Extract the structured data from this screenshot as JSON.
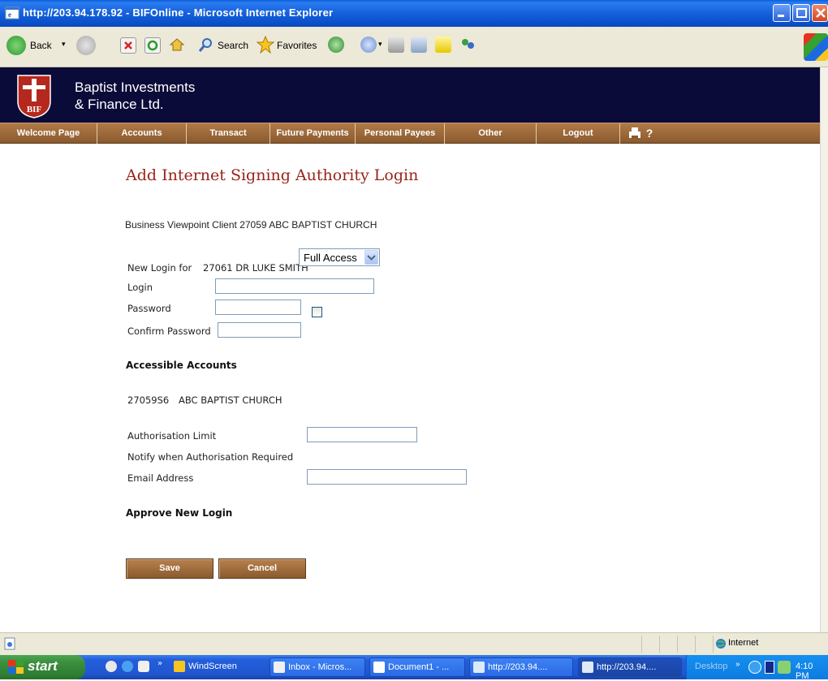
{
  "window": {
    "title": "http://203.94.178.92 - BIFOnline - Microsoft Internet Explorer"
  },
  "toolbar": {
    "back_label": "Back",
    "search_label": "Search",
    "favorites_label": "Favorites"
  },
  "bank": {
    "name_line1": "Baptist Investments",
    "name_line2": "& Finance Ltd.",
    "logo_text": "BIF"
  },
  "nav": {
    "items": [
      {
        "label": "Welcome Page"
      },
      {
        "label": "Accounts"
      },
      {
        "label": "Transact"
      },
      {
        "label": "Future Payments"
      },
      {
        "label": "Personal Payees"
      },
      {
        "label": "Other"
      },
      {
        "label": "Logout"
      }
    ],
    "help_label": "?"
  },
  "page": {
    "title": "Add Internet Signing Authority Login",
    "client_line": "Business Viewpoint Client 27059 ABC BAPTIST CHURCH",
    "new_login_for_label": "New Login for",
    "new_login_for_value": "27061 DR LUKE SMITH",
    "login_label": "Login",
    "login_value": "",
    "password_label": "Password",
    "password_value": "",
    "confirm_password_label": "Confirm Password",
    "confirm_password_value": "",
    "accessible_accounts_heading": "Accessible Accounts",
    "account_number": "27059S6",
    "account_name": "ABC BAPTIST CHURCH",
    "access_selected": "Full Access",
    "authorisation_limit_label": "Authorisation Limit",
    "authorisation_limit_value": "",
    "notify_label": "Notify when Authorisation Required",
    "notify_checked": false,
    "email_label": "Email Address",
    "email_value": "",
    "approve_heading": "Approve New Login",
    "save_label": "Save",
    "cancel_label": "Cancel"
  },
  "statusbar": {
    "zone_label": "Internet"
  },
  "taskbar": {
    "start_label": "start",
    "tasks": [
      {
        "label": "WindScreen"
      },
      {
        "label": "Inbox - Micros..."
      },
      {
        "label": "Document1 - ..."
      },
      {
        "label": "http://203.94...."
      },
      {
        "label": "http://203.94...."
      }
    ],
    "desktop_label": "Desktop",
    "clock": "4:10 PM"
  },
  "colors": {
    "nav_bg": "#9a6a3c",
    "header_bg": "#0b0b3a",
    "title_red": "#9a2318"
  }
}
